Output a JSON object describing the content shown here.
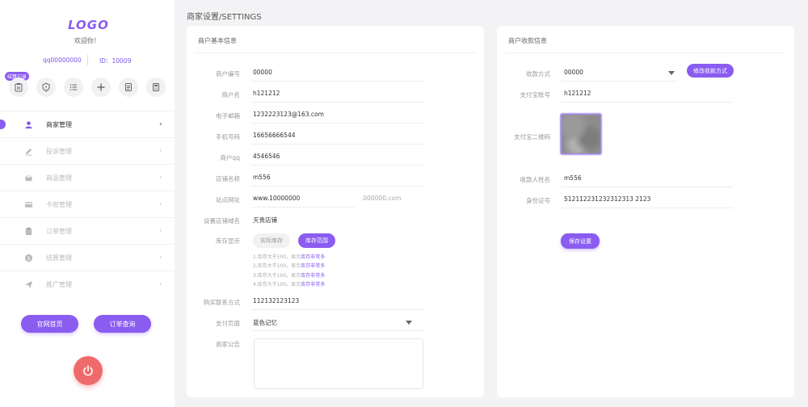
{
  "sidebar": {
    "logo": "LOGO",
    "welcome": "欢迎你！",
    "qq": "qq00000000",
    "uid": "ID：10009",
    "badge": "结算记录",
    "icons": [
      "clipboard-icon",
      "shield-info-icon",
      "list-icon",
      "plus-icon",
      "document-icon",
      "calculator-icon"
    ],
    "nav": [
      {
        "label": "商家管理",
        "icon": "user-icon",
        "active": true
      },
      {
        "label": "投诉管理",
        "icon": "edit-icon",
        "active": false
      },
      {
        "label": "商品管理",
        "icon": "basket-icon",
        "active": false
      },
      {
        "label": "卡密管理",
        "icon": "card-icon",
        "active": false
      },
      {
        "label": "订单管理",
        "icon": "clipboard-icon",
        "active": false
      },
      {
        "label": "结算管理",
        "icon": "coin-icon",
        "active": false
      },
      {
        "label": "推广管理",
        "icon": "send-icon",
        "active": false
      }
    ],
    "home_button": "官网首页",
    "order_query_button": "订单查询"
  },
  "main": {
    "title": "商家设置/SETTINGS",
    "basic": {
      "title": "商户基本信息",
      "fields": [
        {
          "label": "商户编号",
          "value": "00000"
        },
        {
          "label": "商户名",
          "value": "h121212"
        },
        {
          "label": "电子邮箱",
          "value": "1232223123@163.com"
        },
        {
          "label": "手机号码",
          "value": "16656666544"
        },
        {
          "label": "商户qq",
          "value": "4546546"
        },
        {
          "label": "店铺名称",
          "value": "m556"
        }
      ],
      "site_label": "站点网址",
      "site_value": "www.10000000",
      "site_suffix": ".000000.com",
      "shop_domain_label": "设置店铺域名",
      "shop_domain_value": "灭贵店铺",
      "stock_label": "库存显示",
      "stock_actual": "实际库存",
      "stock_range": "库存范围",
      "stock_notes": [
        {
          "prefix": "1.库存大于100，显示",
          "highlight": "库存非常多"
        },
        {
          "prefix": "2.库存大于100，显示",
          "highlight": "库存非常多"
        },
        {
          "prefix": "3.库存大于100，显示",
          "highlight": "库存非常多"
        },
        {
          "prefix": "4.库存大于100，显示",
          "highlight": "库存非常多"
        }
      ],
      "contact_label": "购买联系方式",
      "contact_value": "112132123123",
      "pay_page_label": "支付页面",
      "pay_page_value": "蓝色记忆",
      "notice_label": "商家公告"
    },
    "payment": {
      "title": "商户收款信息",
      "method_label": "收款方式",
      "method_value": "00000",
      "modify_button": "修改收款方式",
      "alipay_label": "支付宝账号",
      "alipay_value": "h121212",
      "qr_label": "支付宝二维码",
      "payee_label": "收款人姓名",
      "payee_value": "m556",
      "id_label": "身份证号",
      "id_value": "512112231232312313 2123",
      "save_button": "保存设置"
    }
  },
  "colors": {
    "accent": "#8a5cf0",
    "danger": "#ef6b6b"
  }
}
